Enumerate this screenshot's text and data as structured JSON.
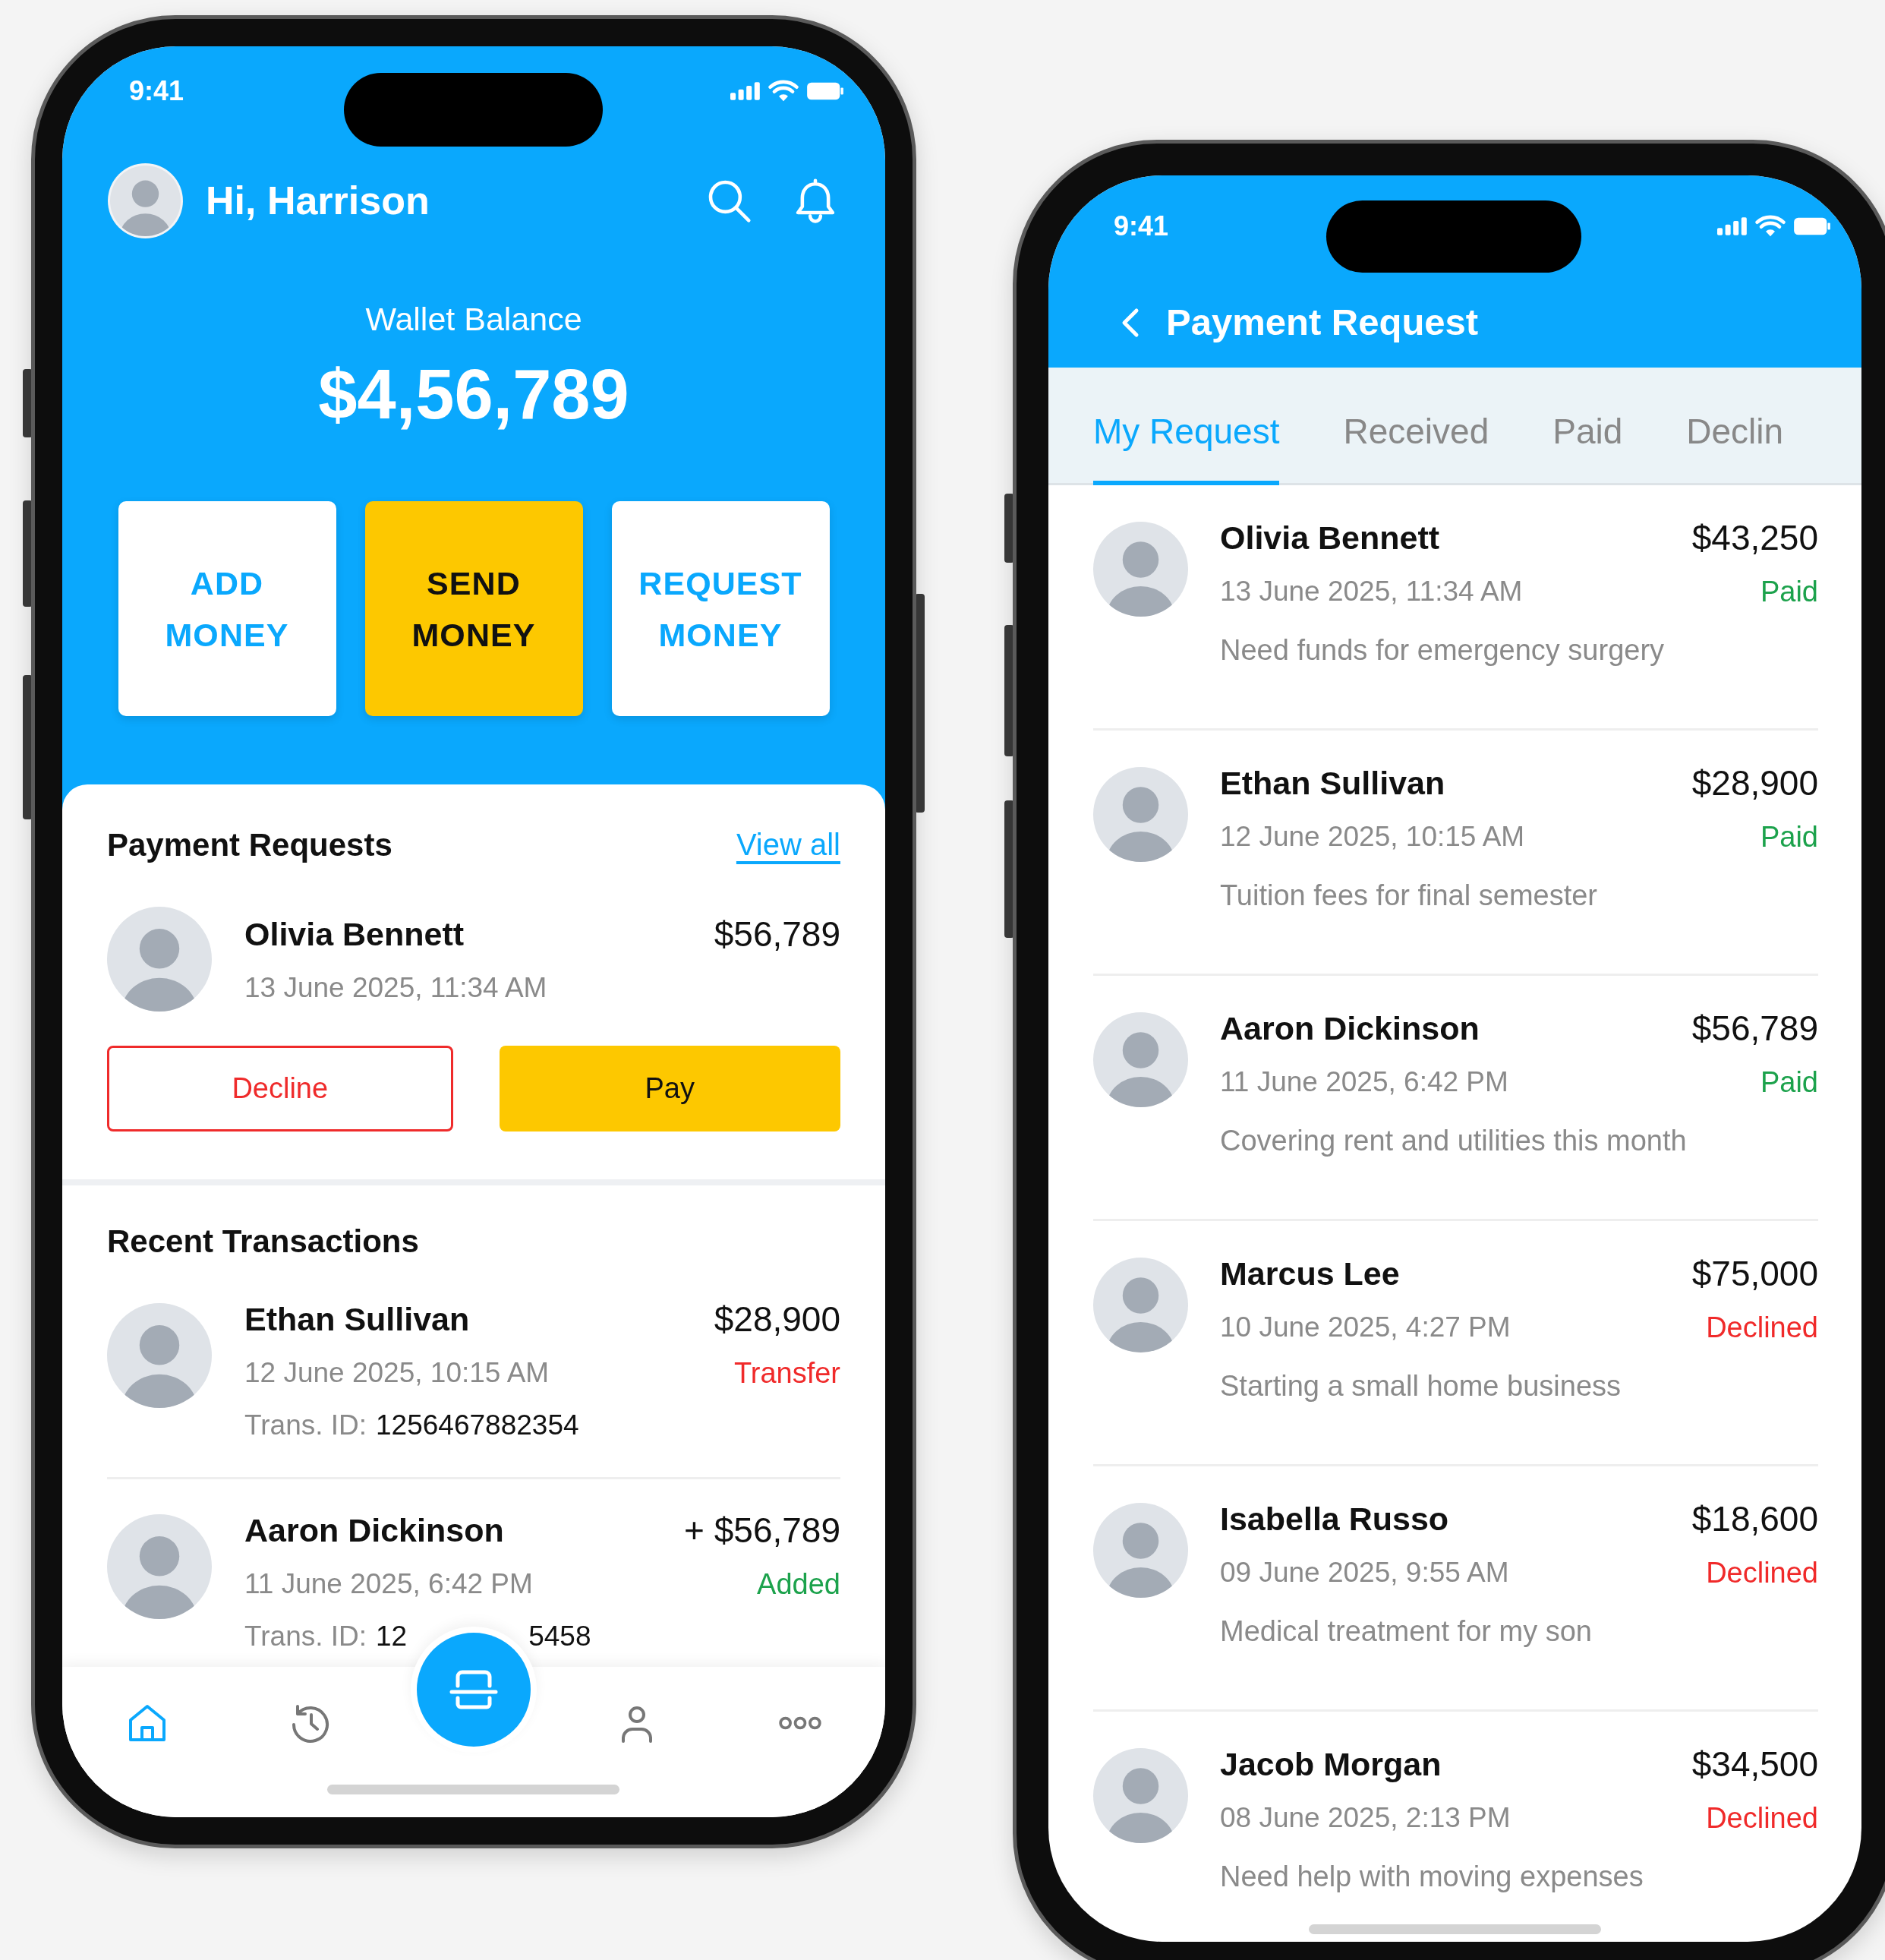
{
  "home_screen": {
    "status_time": "9:41",
    "greeting": "Hi, Harrison",
    "wallet": {
      "label": "Wallet Balance",
      "amount": "$4,56,789"
    },
    "actions": [
      {
        "label": "ADD MONEY",
        "kind": "plain"
      },
      {
        "label": "SEND MONEY",
        "kind": "highlight"
      },
      {
        "label": "REQUEST MONEY",
        "kind": "plain"
      }
    ],
    "payment_requests": {
      "title": "Payment Requests",
      "link": "View all",
      "items": [
        {
          "name": "Olivia Bennett",
          "date": "13 June 2025, 11:34 AM",
          "amount": "$56,789",
          "actions": [
            {
              "label": "Decline",
              "kind": "decline"
            },
            {
              "label": "Pay",
              "kind": "pay"
            }
          ]
        }
      ]
    },
    "recent_transactions": {
      "title": "Recent Transactions",
      "items": [
        {
          "name": "Ethan Sullivan",
          "date": "12 June 2025, 10:15 AM",
          "amount": "$28,900",
          "status": "Transfer",
          "color": "#f02a2a",
          "id_label": "Trans. ID:",
          "id_parts": [
            "1256467882354"
          ]
        },
        {
          "name": "Aaron Dickinson",
          "date": "11 June 2025, 6:42 PM",
          "amount": "+ $56,789",
          "status": "Added",
          "color": "#1ca24c",
          "id_label": "Trans. ID:",
          "id_parts": [
            "12",
            "5458"
          ]
        }
      ]
    },
    "nav": [
      {
        "kind": "home",
        "selected": true
      },
      {
        "kind": "history",
        "selected": false
      },
      {
        "kind": "scan",
        "selected": false
      },
      {
        "kind": "profile",
        "selected": false
      },
      {
        "kind": "more",
        "selected": false
      }
    ]
  },
  "payment_request_screen": {
    "status_time": "9:41",
    "title": "Payment Request",
    "tabs": [
      {
        "label": "My Request",
        "selected": true
      },
      {
        "label": "Received",
        "selected": false
      },
      {
        "label": "Paid",
        "selected": false
      },
      {
        "label": "Declin",
        "selected": false
      }
    ],
    "requests": [
      {
        "name": "Olivia Bennett",
        "amount": "$43,250",
        "date": "13 June 2025, 11:34 AM",
        "status": "Paid",
        "color": "#1ca24c",
        "note": "Need funds for emergency surgery"
      },
      {
        "name": "Ethan Sullivan",
        "amount": "$28,900",
        "date": "12 June 2025, 10:15 AM",
        "status": "Paid",
        "color": "#1ca24c",
        "note": "Tuition fees for final semester"
      },
      {
        "name": "Aaron Dickinson",
        "amount": "$56,789",
        "date": "11 June 2025, 6:42 PM",
        "status": "Paid",
        "color": "#1ca24c",
        "note": "Covering rent and utilities this month"
      },
      {
        "name": "Marcus Lee",
        "amount": "$75,000",
        "date": "10 June 2025, 4:27 PM",
        "status": "Declined",
        "color": "#f02a2a",
        "note": "Starting a small home business"
      },
      {
        "name": "Isabella Russo",
        "amount": "$18,600",
        "date": "09 June 2025, 9:55 AM",
        "status": "Declined",
        "color": "#f02a2a",
        "note": "Medical treatment for my son"
      },
      {
        "name": "Jacob Morgan",
        "amount": "$34,500",
        "date": "08 June 2025, 2:13 PM",
        "status": "Declined",
        "color": "#f02a2a",
        "note": "Need help with moving expenses"
      }
    ]
  }
}
